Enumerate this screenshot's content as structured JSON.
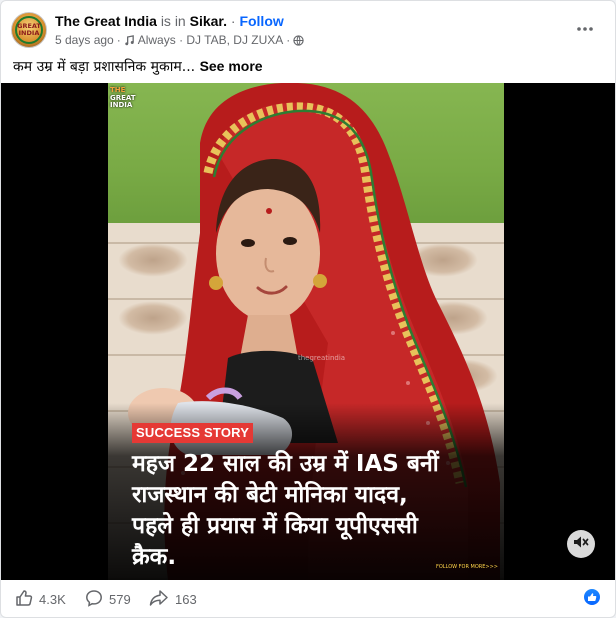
{
  "post": {
    "page_name": "The Great India",
    "is_in": "is in",
    "location": "Sikar.",
    "separator": "·",
    "follow_label": "Follow",
    "time": "5 days ago",
    "dot": "·",
    "music_track": "Always · DJ TAB, DJ ZUXA",
    "privacy_dot": "·",
    "caption": "कम उम्र में बड़ा प्रशासनिक मुकाम...",
    "see_more": "See more",
    "avatar_text": "GREAT INDIA"
  },
  "media": {
    "logo_line1": "THE",
    "logo_line2": "GREAT",
    "logo_line3": "INDIA",
    "watermark": "thegreatindia",
    "badge": "SUCCESS STORY",
    "headline_line1": "महज 22 साल की उम्र में IAS बनीं",
    "headline_line2": "राजस्थान की बेटी मोनिका यादव,",
    "headline_line3": "पहले ही प्रयास में किया यूपीएससी",
    "headline_line4": "क्रैक.",
    "follow_note": "FOLLOW FOR MORE>>>",
    "colors": {
      "badge": "#e53935",
      "wall": "#79aa45",
      "scarf": "#c62828"
    }
  },
  "footer": {
    "likes": "4.3K",
    "comments": "579",
    "shares": "163"
  },
  "icons": {
    "more": "more-horizontal-icon",
    "music": "music-note-icon",
    "globe": "globe-icon",
    "mute": "sound-muted-icon",
    "like": "thumbs-up-icon",
    "comment": "comment-icon",
    "share": "share-icon",
    "reaction": "like-reaction-icon"
  }
}
